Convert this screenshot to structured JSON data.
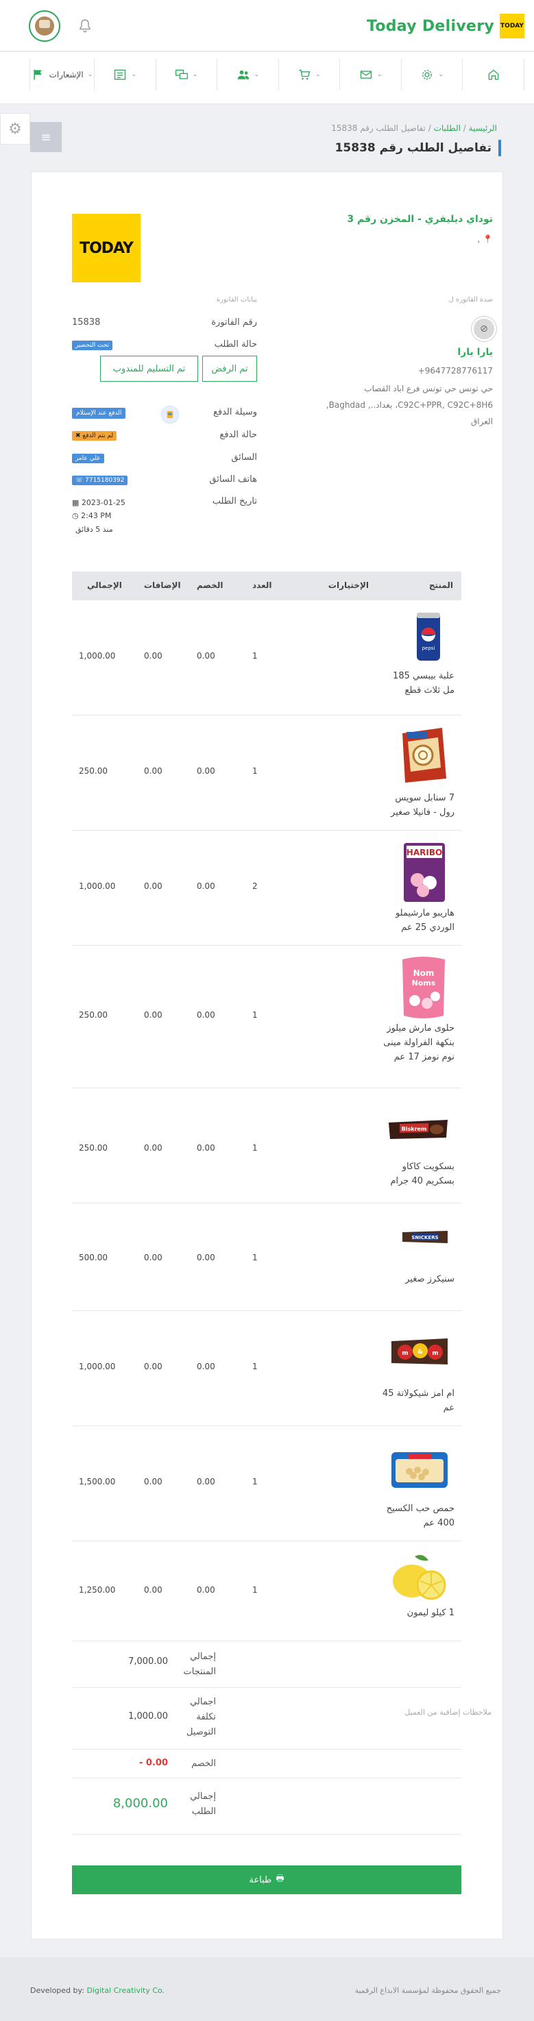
{
  "header": {
    "brand_name": "Today Delivery",
    "brand_logo_text": "TODAY"
  },
  "nav": {
    "items": [
      {
        "icon": "home-icon",
        "label": ""
      },
      {
        "icon": "settings-icon",
        "label": ""
      },
      {
        "icon": "mail-icon",
        "label": ""
      },
      {
        "icon": "cart-icon",
        "label": ""
      },
      {
        "icon": "users-icon",
        "label": ""
      },
      {
        "icon": "chat-icon",
        "label": ""
      },
      {
        "icon": "list-icon",
        "label": ""
      },
      {
        "icon": "flag-icon",
        "label": "الإشعارات"
      }
    ]
  },
  "breadcrumb": {
    "home": "الرئيسية",
    "orders": "الطلبات",
    "current": "تفاصيل الطلب رقم 15838"
  },
  "page": {
    "title": "تفاصيل الطلب رقم 15838"
  },
  "store": {
    "name": "توداي ديليفري - المخزن رقم 3",
    "location": ",",
    "logo_text": "TODAY"
  },
  "invoice_to": {
    "label": "صدة الفاتورة ل",
    "name": "يارا يارا",
    "phone": "+9647728776117",
    "address": "حي تونس حي تونس فرع اباد القصاب C92C+PPR, C92C+8H6، بغداد.., Baghdad, العراق"
  },
  "invoice": {
    "section_label": "بيانات الفاتورة",
    "number_label": "رقم الفاتورة",
    "number": "15838",
    "status_label": "حالة الطلب",
    "status_badge": "تحت التحضير",
    "reject_button": "تم الرفض",
    "delivered_button": "تم التسليم للمندوب",
    "payment_method_label": "وسيلة الدفع",
    "payment_method": "الدفع عند الإستلام",
    "payment_status_label": "حالة الدفع",
    "payment_status": "لم يتم الدفع",
    "driver_label": "السائق",
    "driver": "علي عامر",
    "driver_phone_label": "هاتف السائق",
    "driver_phone": "7715180392",
    "date_label": "تاريخ الطلب",
    "date": "2023-01-25",
    "time": "2:43 PM",
    "ago": "منذ 5 دقائق"
  },
  "table": {
    "headers": {
      "product": "المنتج",
      "options": "الإختيارات",
      "qty": "العدد",
      "discount": "الخصم",
      "extras": "الإضافات",
      "total": "الإجمالي"
    },
    "rows": [
      {
        "name": "علبة بيبسي 185 مل ثلاث قطع",
        "qty": "1",
        "discount": "0.00",
        "extras": "0.00",
        "total": "1,000.00",
        "img": "pepsi"
      },
      {
        "name": "7 سنابل سويس رول - فانيلا صغير",
        "qty": "1",
        "discount": "0.00",
        "extras": "0.00",
        "total": "250.00",
        "img": "swissroll"
      },
      {
        "name": "هاريبو مارشيملو الوردي 25 عم",
        "qty": "2",
        "discount": "0.00",
        "extras": "0.00",
        "total": "1,000.00",
        "img": "haribo"
      },
      {
        "name": "حلوى مارش ميلوز بنكهة الفراولة مينى نوم نومز 17 عم",
        "qty": "1",
        "discount": "0.00",
        "extras": "0.00",
        "total": "250.00",
        "img": "marsh"
      },
      {
        "name": "بسكويت كاكاو بسكريم 40 جرام",
        "qty": "1",
        "discount": "0.00",
        "extras": "0.00",
        "total": "250.00",
        "img": "biscuit"
      },
      {
        "name": "سنيكرز صغير",
        "qty": "1",
        "discount": "0.00",
        "extras": "0.00",
        "total": "500.00",
        "img": "snickers"
      },
      {
        "name": "ام امز شيكولاتة 45 عم",
        "qty": "1",
        "discount": "0.00",
        "extras": "0.00",
        "total": "1,000.00",
        "img": "mms"
      },
      {
        "name": "حمص حب الكسيح 400 عم",
        "qty": "1",
        "discount": "0.00",
        "extras": "0.00",
        "total": "1,500.00",
        "img": "hummus"
      },
      {
        "name": "1 كيلو ليمون",
        "qty": "1",
        "discount": "0.00",
        "extras": "0.00",
        "total": "1,250.00",
        "img": "lemon"
      }
    ]
  },
  "summary": {
    "products_total_label": "إجمالي المنتجات",
    "products_total": "7,000.00",
    "delivery_label": "اجمالي تكلفة التوصيل",
    "delivery": "1,000.00",
    "discount_label": "الخصم",
    "discount": "- 0.00",
    "order_total_label": "إجمالي الطلب",
    "order_total": "8,000.00",
    "notes_label": "ملاحظات إضافية من العميل"
  },
  "actions": {
    "print": "طباعة"
  },
  "footer": {
    "rights": "جميع الحقوق محفوظة لمؤسسة الابداع الرقمية",
    "developed_prefix": "Developed by: ",
    "developer": "Digital Creativity Co."
  },
  "colors": {
    "accent": "#2fa95a",
    "brand_yellow": "#ffd200",
    "badge_blue": "#4a8fdc",
    "badge_orange": "#f2a43a",
    "danger": "#e53935"
  }
}
